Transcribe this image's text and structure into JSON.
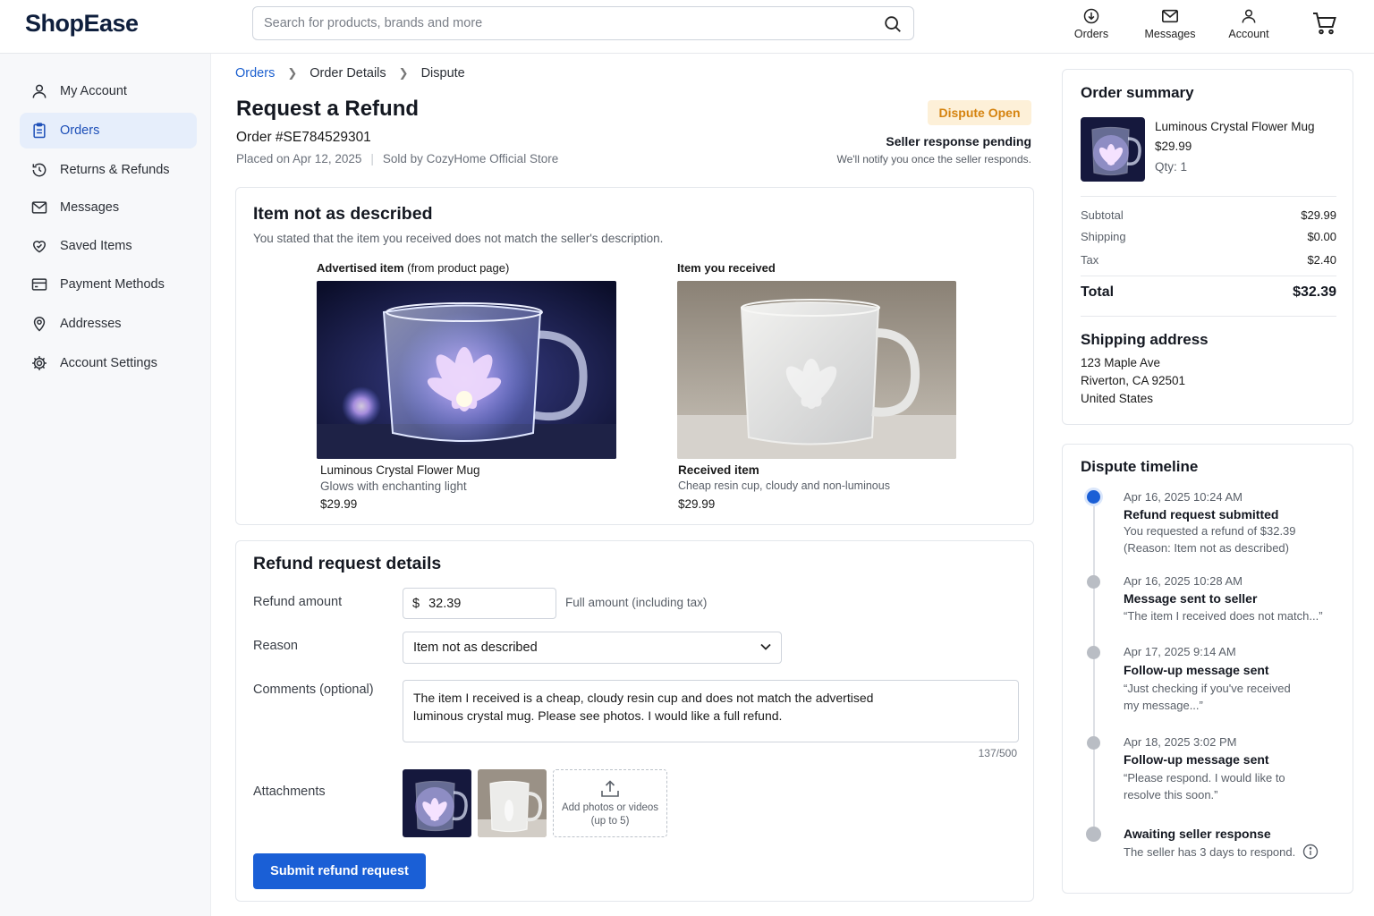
{
  "header": {
    "logo": "ShopEase",
    "search_placeholder": "Search for products, brands and more",
    "nav": {
      "orders": "Orders",
      "messages": "Messages",
      "account": "Account"
    }
  },
  "sidebar": {
    "items": [
      {
        "label": "My Account",
        "icon": "user-icon"
      },
      {
        "label": "Orders",
        "icon": "clipboard-icon",
        "active": true
      },
      {
        "label": "Returns & Refunds",
        "icon": "return-icon"
      },
      {
        "label": "Messages",
        "icon": "mail-icon"
      },
      {
        "label": "Saved Items",
        "icon": "heart-icon"
      },
      {
        "label": "Payment Methods",
        "icon": "card-icon"
      },
      {
        "label": "Addresses",
        "icon": "location-icon"
      },
      {
        "label": "Account Settings",
        "icon": "gear-icon"
      }
    ]
  },
  "breadcrumb": {
    "orders": "Orders",
    "order_details": "Order Details",
    "dispute": "Dispute"
  },
  "page": {
    "title": "Request a Refund",
    "order_number": "Order #SE784529301",
    "placed": "Placed on Apr 12, 2025",
    "seller": "Sold by CozyHome Official Store",
    "badge": "Dispute Open",
    "pending": "Seller response pending",
    "notify": "We'll notify you once the seller responds."
  },
  "issue": {
    "title": "Item not as described",
    "desc": "You stated that the item you received does not match the seller's description.",
    "advertised_label_bold": "Advertised item",
    "advertised_label_rest": " (from product page)",
    "received_label": "Item you received",
    "advertised": {
      "name": "Luminous Crystal Flower Mug",
      "desc": "Glows with enchanting light",
      "price": "$29.99"
    },
    "received": {
      "name": "Received item",
      "desc": "Cheap resin cup, cloudy and non-luminous",
      "price": "$29.99"
    }
  },
  "refund": {
    "title": "Refund request details",
    "amount_label": "Refund amount",
    "currency": "$",
    "amount": "32.39",
    "amount_hint": "Full amount (including tax)",
    "reason_label": "Reason",
    "reason": "Item not as described",
    "comments_label": "Comments (optional)",
    "comments": "The item I received is a cheap, cloudy resin cup and does not match the advertised\nluminous crystal mug. Please see photos. I would like a full refund.",
    "counter": "137/500",
    "attachments_label": "Attachments",
    "add_media_line1": "Add photos or videos",
    "add_media_line2": "(up to 5)",
    "submit": "Submit refund request"
  },
  "summary": {
    "title": "Order summary",
    "item_name": "Luminous Crystal Flower Mug",
    "item_price": "$29.99",
    "qty": "Qty: 1",
    "subtotal_label": "Subtotal",
    "subtotal": "$29.99",
    "shipping_label": "Shipping",
    "shipping": "$0.00",
    "tax_label": "Tax",
    "tax": "$2.40",
    "total_label": "Total",
    "total": "$32.39",
    "address_title": "Shipping address",
    "address": [
      "123 Maple Ave",
      "Riverton, CA 92501",
      "United States"
    ]
  },
  "timeline": {
    "title": "Dispute timeline",
    "events": [
      {
        "date": "Apr 16, 2025  10:24 AM",
        "title": "Refund request submitted",
        "text": "You requested a refund of $32.39\n(Reason: Item not as described)"
      },
      {
        "date": "Apr 16, 2025  10:28 AM",
        "title": "Message sent to seller",
        "text": "“The item I received does not match...”"
      },
      {
        "date": "Apr 17, 2025  9:14 AM",
        "title": "Follow-up message sent",
        "text": "“Just checking if you've received\nmy message...”"
      },
      {
        "date": "Apr 18, 2025  3:02 PM",
        "title": "Follow-up message sent",
        "text": "“Please respond. I would like to\nresolve this soon.”"
      },
      {
        "date": "",
        "title": "Awaiting seller response",
        "text": "The seller has 3 days to respond."
      }
    ]
  }
}
